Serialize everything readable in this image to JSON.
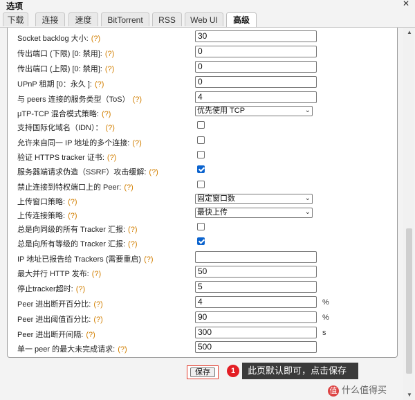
{
  "window": {
    "title": "选项",
    "close_glyph": "✕"
  },
  "tabs": [
    {
      "label": "下载"
    },
    {
      "label": "连接"
    },
    {
      "label": "速度"
    },
    {
      "label": "BitTorrent"
    },
    {
      "label": "RSS"
    },
    {
      "label": "Web UI"
    },
    {
      "label": "高级"
    }
  ],
  "active_tab": "高级",
  "help_marker": "(?)",
  "settings": [
    {
      "label": "Socket backlog 大小:",
      "type": "text",
      "value": "30"
    },
    {
      "label": "传出端口 (下限) [0: 禁用]:",
      "type": "text",
      "value": "0"
    },
    {
      "label": "传出端口 (上限) [0: 禁用]:",
      "type": "text",
      "value": "0"
    },
    {
      "label": "UPnP 租期 [0：永久 ]:",
      "type": "text",
      "value": "0"
    },
    {
      "label": "与 peers 连接的服务类型（ToS）",
      "type": "text",
      "value": "4"
    },
    {
      "label": "μTP-TCP 混合模式策略:",
      "type": "select",
      "value": "优先使用 TCP"
    },
    {
      "label": "支持国际化域名（IDN）：",
      "type": "checkbox",
      "checked": false
    },
    {
      "label": "允许来自同一 IP 地址的多个连接:",
      "type": "checkbox",
      "checked": false
    },
    {
      "label": "验证 HTTPS tracker 证书:",
      "type": "checkbox",
      "checked": false
    },
    {
      "label": "服务器端请求伪造（SSRF）攻击缓解:",
      "type": "checkbox",
      "checked": true
    },
    {
      "label": "禁止连接到特权端口上的 Peer:",
      "type": "checkbox",
      "checked": false
    },
    {
      "label": "上传窗口策略:",
      "type": "select",
      "value": "固定窗口数"
    },
    {
      "label": "上传连接策略:",
      "type": "select",
      "value": "最快上传"
    },
    {
      "label": "总是向同级的所有 Tracker 汇报:",
      "type": "checkbox",
      "checked": false
    },
    {
      "label": "总是向所有等级的 Tracker 汇报:",
      "type": "checkbox",
      "checked": true
    },
    {
      "label": "IP 地址已报告给 Trackers (需要重启)",
      "type": "text",
      "value": ""
    },
    {
      "label": "最大并行 HTTP 发布:",
      "type": "text",
      "value": "50"
    },
    {
      "label": "停止tracker超时:",
      "type": "text",
      "value": "5"
    },
    {
      "label": "Peer 进出断开百分比:",
      "type": "text",
      "value": "4",
      "unit": "%"
    },
    {
      "label": "Peer 进出阈值百分比:",
      "type": "text",
      "value": "90",
      "unit": "%"
    },
    {
      "label": "Peer 进出断开间隔:",
      "type": "text",
      "value": "300",
      "unit": "s"
    },
    {
      "label": "单一 peer 的最大未完成请求:",
      "type": "text",
      "value": "500"
    }
  ],
  "save_button": {
    "label": "保存"
  },
  "annotation": {
    "number": "1",
    "text": "此页默认即可，点击保存"
  },
  "watermark": {
    "text": "什么值得买",
    "icon_glyph": "值"
  },
  "colors": {
    "help": "#d27f00",
    "checkbox_on": "#0b63ce",
    "badge": "#e31e24",
    "tooltip_bg": "#3a3a3a"
  }
}
